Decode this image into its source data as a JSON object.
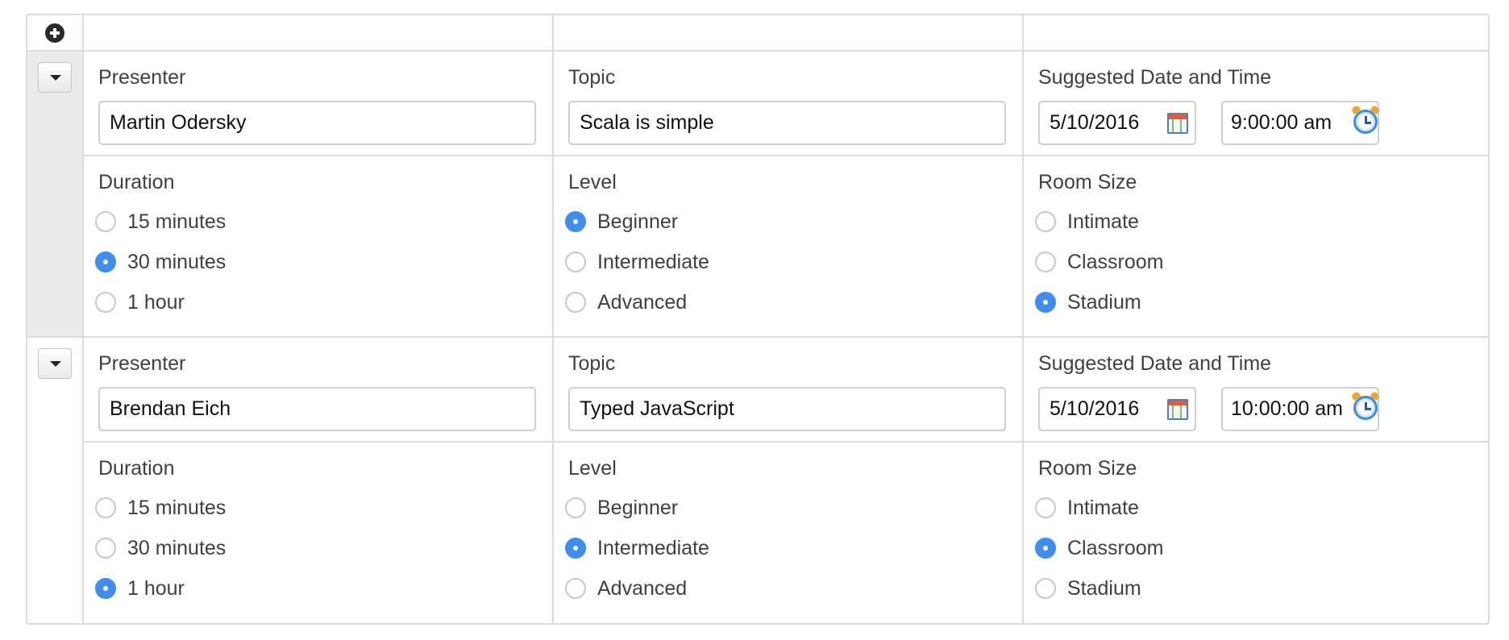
{
  "labels": {
    "presenter": "Presenter",
    "topic": "Topic",
    "suggested_datetime": "Suggested Date and Time",
    "duration": "Duration",
    "level": "Level",
    "room_size": "Room Size"
  },
  "icons": {
    "add": "plus-circle-icon",
    "toggle": "caret-down-icon",
    "date": "calendar-icon",
    "time": "alarm-clock-icon"
  },
  "colors": {
    "accent": "#3d8ef0",
    "border": "#dcdcdc",
    "selected_row": "#ebebeb"
  },
  "rows": [
    {
      "presenter": "Martin Odersky",
      "topic": "Scala is simple",
      "date": "5/10/2016",
      "time": "9:00:00 am",
      "selected": true,
      "duration_options": [
        {
          "label": "15 minutes",
          "checked": false
        },
        {
          "label": "30 minutes",
          "checked": true
        },
        {
          "label": "1 hour",
          "checked": false
        }
      ],
      "level_options": [
        {
          "label": "Beginner",
          "checked": true
        },
        {
          "label": "Intermediate",
          "checked": false
        },
        {
          "label": "Advanced",
          "checked": false
        }
      ],
      "room_options": [
        {
          "label": "Intimate",
          "checked": false
        },
        {
          "label": "Classroom",
          "checked": false
        },
        {
          "label": "Stadium",
          "checked": true
        }
      ]
    },
    {
      "presenter": "Brendan Eich",
      "topic": "Typed JavaScript",
      "date": "5/10/2016",
      "time": "10:00:00 am",
      "selected": false,
      "duration_options": [
        {
          "label": "15 minutes",
          "checked": false
        },
        {
          "label": "30 minutes",
          "checked": false
        },
        {
          "label": "1 hour",
          "checked": true
        }
      ],
      "level_options": [
        {
          "label": "Beginner",
          "checked": false
        },
        {
          "label": "Intermediate",
          "checked": true
        },
        {
          "label": "Advanced",
          "checked": false
        }
      ],
      "room_options": [
        {
          "label": "Intimate",
          "checked": false
        },
        {
          "label": "Classroom",
          "checked": true
        },
        {
          "label": "Stadium",
          "checked": false
        }
      ]
    }
  ]
}
